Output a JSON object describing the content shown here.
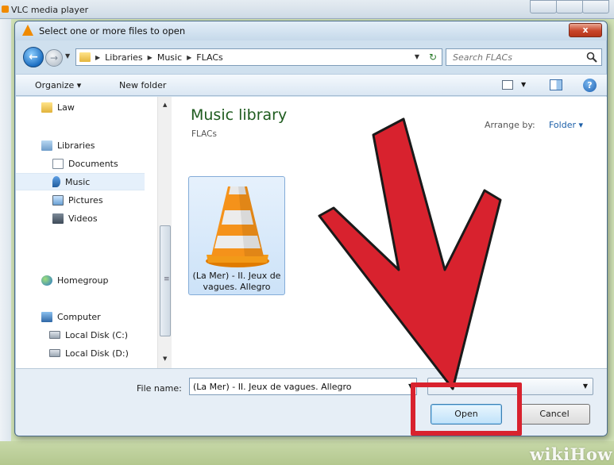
{
  "background_window": {
    "title": "VLC media player"
  },
  "dialog": {
    "title": "Select one or more files to open",
    "close_label": "x"
  },
  "address_bar": {
    "crumbs": [
      "Libraries",
      "Music",
      "FLACs"
    ],
    "search_placeholder": "Search FLACs"
  },
  "toolbar": {
    "organize_label": "Organize ▾",
    "new_folder_label": "New folder"
  },
  "nav_pane": {
    "items": [
      {
        "label": "Law",
        "icon": "folder-icon"
      },
      {
        "label": "Libraries",
        "icon": "libraries-icon"
      },
      {
        "label": "Documents",
        "icon": "documents-icon"
      },
      {
        "label": "Music",
        "icon": "music-icon",
        "selected": true
      },
      {
        "label": "Pictures",
        "icon": "pictures-icon"
      },
      {
        "label": "Videos",
        "icon": "videos-icon"
      },
      {
        "label": "Homegroup",
        "icon": "homegroup-icon"
      },
      {
        "label": "Computer",
        "icon": "computer-icon"
      },
      {
        "label": "Local Disk (C:)",
        "icon": "disk-icon"
      },
      {
        "label": "Local Disk (D:)",
        "icon": "disk-icon"
      }
    ]
  },
  "main_pane": {
    "library_title": "Music library",
    "library_subtitle": "FLACs",
    "arrange_by_label": "Arrange by:",
    "arrange_by_value": "Folder ▾",
    "file": {
      "name": "(La Mer) - II. Jeux de vagues. Allegro",
      "icon": "vlc-cone-icon"
    }
  },
  "bottom_bar": {
    "file_name_label": "File name:",
    "file_name_value": "(La Mer) - II. Jeux de vagues. Allegro",
    "open_button": "Open",
    "cancel_button": "Cancel"
  },
  "annotation": {
    "arrow_color": "#d8222e",
    "highlight_target": "open-button"
  },
  "watermark": "wikiHow"
}
